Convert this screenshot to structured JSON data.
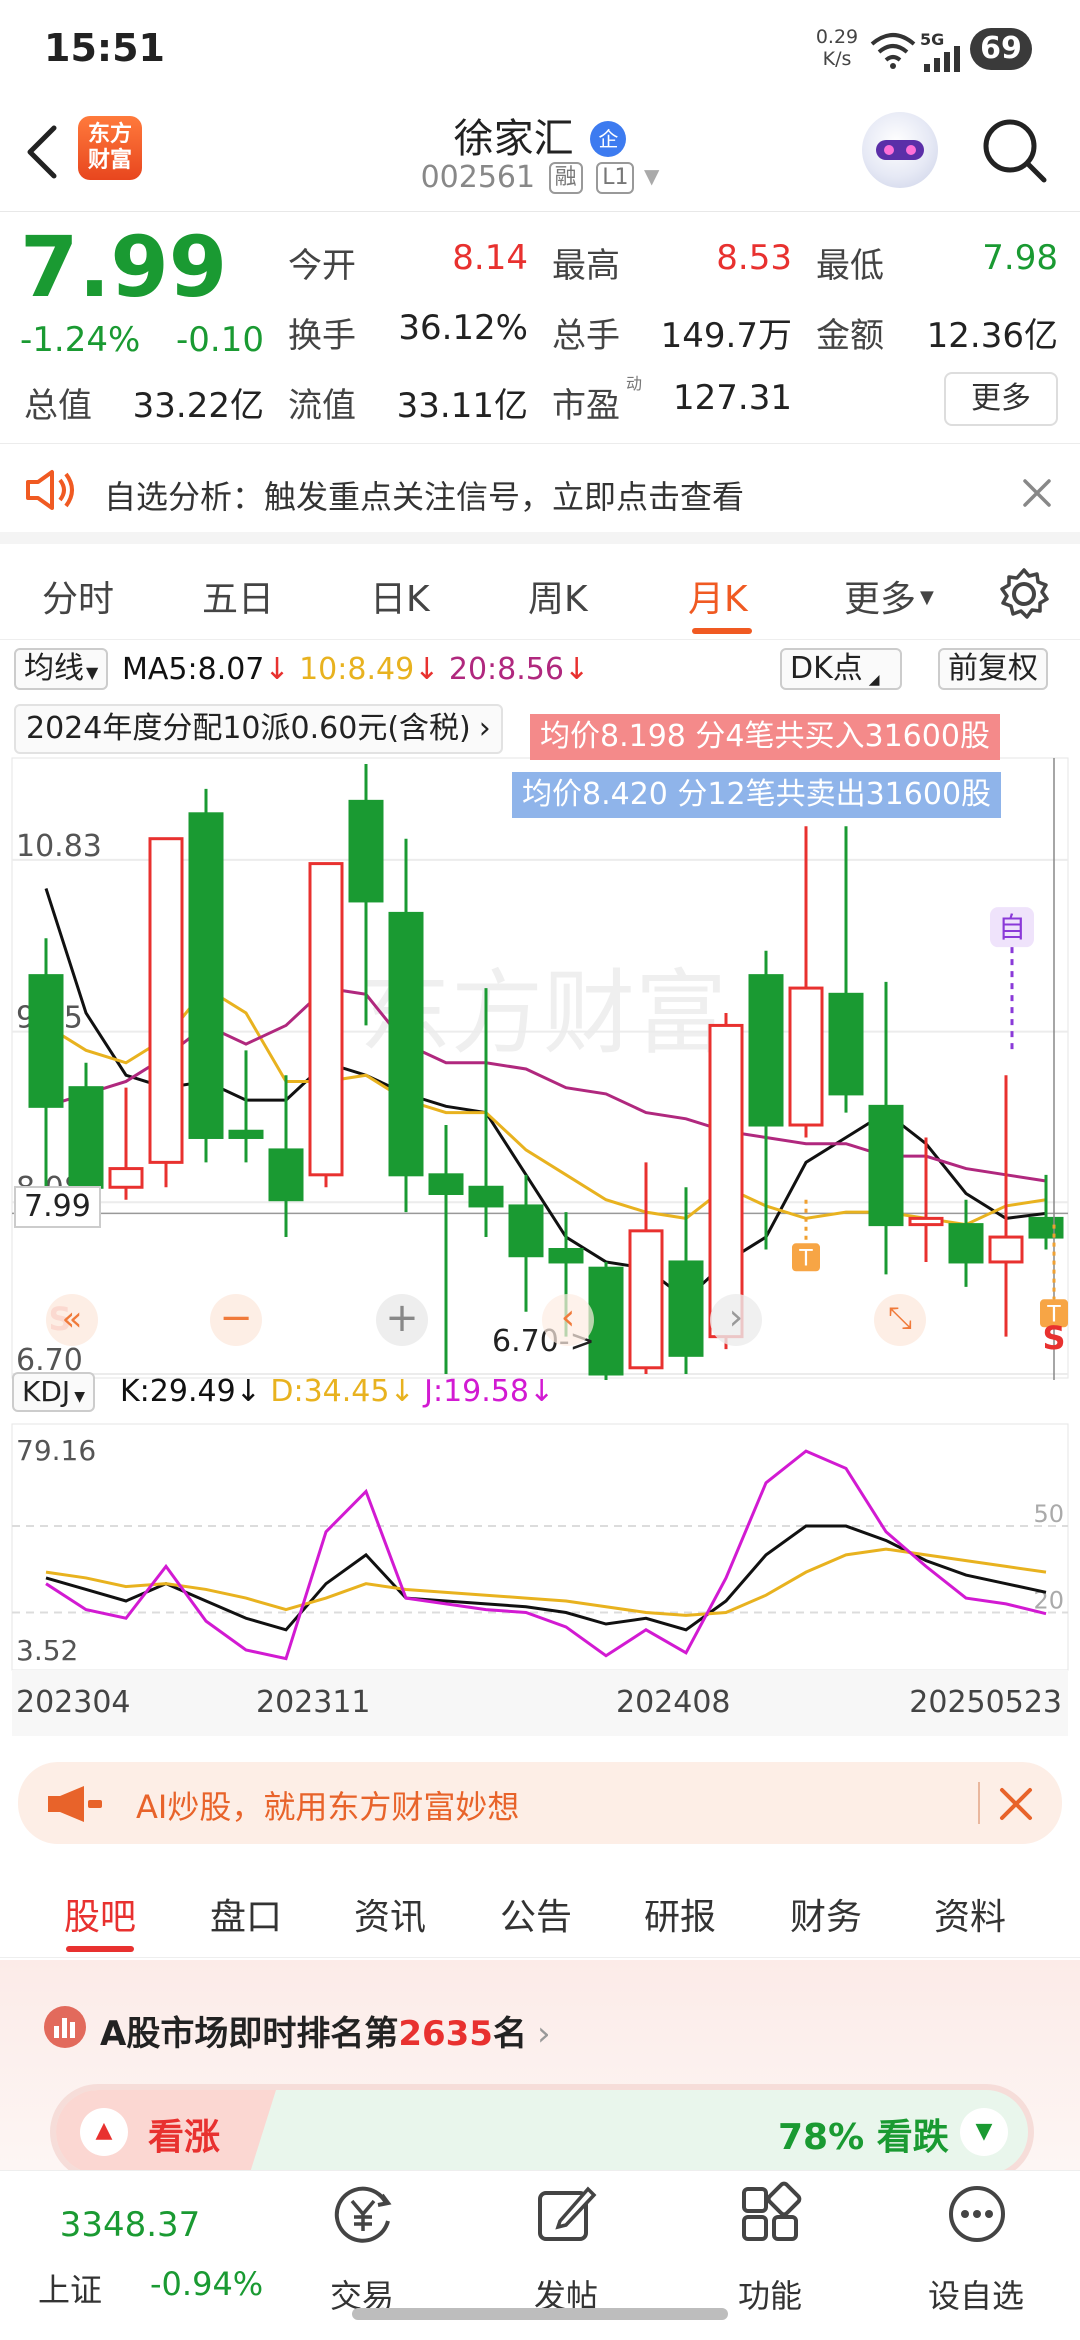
{
  "status_bar": {
    "time": "15:51",
    "net_speed_value": "0.29",
    "net_speed_unit": "K/s",
    "network": "5G",
    "battery": "69"
  },
  "header": {
    "logo_line1": "东方",
    "logo_line2": "财富",
    "stock_name": "徐家汇",
    "badge": "企",
    "stock_code": "002561",
    "tag_margin": "融",
    "tag_level": "L1"
  },
  "quote": {
    "price": "7.99",
    "change_pct": "-1.24%",
    "change": "-0.10",
    "open_label": "今开",
    "open": "8.14",
    "high_label": "最高",
    "high": "8.53",
    "low_label": "最低",
    "low": "7.98",
    "turnover_label": "换手",
    "turnover": "36.12%",
    "volume_label": "总手",
    "volume": "149.7万",
    "amount_label": "金额",
    "amount": "12.36亿",
    "mcap_label": "总值",
    "mcap": "33.22亿",
    "float_label": "流值",
    "float_mcap": "33.11亿",
    "pe_label": "市盈",
    "pe_sup": "动",
    "pe": "127.31",
    "more_label": "更多"
  },
  "alert": {
    "text": "自选分析：触发重点关注信号，立即点击查看"
  },
  "period_tabs": [
    {
      "label": "分时",
      "active": false
    },
    {
      "label": "五日",
      "active": false
    },
    {
      "label": "日K",
      "active": false
    },
    {
      "label": "周K",
      "active": false
    },
    {
      "label": "月K",
      "active": true
    },
    {
      "label": "更多",
      "active": false
    }
  ],
  "chart_header": {
    "indicator_select": "均线",
    "ma5": "MA5:8.07",
    "ma10": "10:8.49",
    "ma20": "20:8.56",
    "dk_label": "DK点",
    "adjust_label": "前复权",
    "dividend_note": "2024年度分配10派0.60元(含税)",
    "buy_note": "均价8.198  分4笔共买入31600股",
    "sell_note": "均价8.420  分12笔共卖出31600股"
  },
  "chart_data": [
    {
      "type": "candlestick",
      "title": "",
      "y_ticks": [
        "10.83",
        "9.45",
        "8.08",
        "6.70"
      ],
      "last_price_label": "7.99",
      "min_marker": "6.70->",
      "ylim": [
        6.7,
        11.6
      ],
      "candles": [
        {
          "o": 9.9,
          "c": 8.85,
          "h": 10.2,
          "l": 8.1
        },
        {
          "o": 9.0,
          "c": 8.2,
          "h": 9.2,
          "l": 7.9
        },
        {
          "o": 8.2,
          "c": 8.35,
          "h": 9.0,
          "l": 8.1
        },
        {
          "o": 8.4,
          "c": 11.0,
          "h": 11.0,
          "l": 8.2
        },
        {
          "o": 11.2,
          "c": 8.6,
          "h": 11.4,
          "l": 8.4
        },
        {
          "o": 8.65,
          "c": 8.6,
          "h": 9.3,
          "l": 8.4
        },
        {
          "o": 8.5,
          "c": 8.1,
          "h": 9.1,
          "l": 7.8
        },
        {
          "o": 8.3,
          "c": 10.8,
          "h": 10.8,
          "l": 8.2
        },
        {
          "o": 11.3,
          "c": 10.5,
          "h": 11.6,
          "l": 9.5
        },
        {
          "o": 10.4,
          "c": 8.3,
          "h": 11.0,
          "l": 8.0
        },
        {
          "o": 8.3,
          "c": 8.15,
          "h": 8.7,
          "l": 6.7
        },
        {
          "o": 8.2,
          "c": 8.05,
          "h": 9.8,
          "l": 7.8
        },
        {
          "o": 8.05,
          "c": 7.65,
          "h": 8.3,
          "l": 7.2
        },
        {
          "o": 7.7,
          "c": 7.6,
          "h": 8.0,
          "l": 7.0
        },
        {
          "o": 7.55,
          "c": 6.7,
          "h": 7.6,
          "l": 6.6
        },
        {
          "o": 6.75,
          "c": 7.85,
          "h": 8.4,
          "l": 6.7
        },
        {
          "o": 7.6,
          "c": 6.85,
          "h": 8.2,
          "l": 6.7
        },
        {
          "o": 7.0,
          "c": 9.5,
          "h": 9.6,
          "l": 6.9
        },
        {
          "o": 9.9,
          "c": 8.7,
          "h": 10.1,
          "l": 7.7
        },
        {
          "o": 8.7,
          "c": 9.8,
          "h": 11.1,
          "l": 8.6
        },
        {
          "o": 9.75,
          "c": 8.95,
          "h": 11.1,
          "l": 8.8
        },
        {
          "o": 8.85,
          "c": 7.9,
          "h": 9.85,
          "l": 7.5
        },
        {
          "o": 7.9,
          "c": 7.95,
          "h": 8.6,
          "l": 7.6
        },
        {
          "o": 7.9,
          "c": 7.6,
          "h": 8.1,
          "l": 7.4
        },
        {
          "o": 7.6,
          "c": 7.8,
          "h": 9.1,
          "l": 7.0
        },
        {
          "o": 7.95,
          "c": 7.8,
          "h": 8.3,
          "l": 7.7
        }
      ],
      "series": [
        {
          "name": "MA5",
          "color": "#111111",
          "values": [
            10.6,
            9.6,
            9.1,
            9.0,
            9.05,
            8.9,
            8.9,
            9.2,
            9.1,
            8.95,
            8.85,
            8.8,
            8.3,
            7.8,
            7.6,
            7.55,
            7.3,
            7.6,
            7.8,
            8.4,
            8.6,
            8.8,
            8.55,
            8.15,
            7.95,
            7.99
          ]
        },
        {
          "name": "MA10",
          "color": "#e8b21f",
          "values": [
            9.5,
            9.3,
            9.2,
            9.4,
            9.8,
            9.6,
            9.05,
            9.05,
            9.1,
            8.9,
            8.8,
            8.8,
            8.5,
            8.3,
            8.1,
            8.0,
            7.95,
            8.2,
            8.05,
            7.95,
            8.0,
            8.0,
            7.95,
            7.9,
            8.05,
            8.1
          ]
        },
        {
          "name": "MA20",
          "color": "#b0287e",
          "values": [
            8.85,
            8.95,
            9.05,
            9.25,
            9.5,
            9.35,
            9.5,
            9.8,
            9.75,
            9.35,
            9.2,
            9.2,
            9.15,
            9.0,
            8.95,
            8.8,
            8.75,
            8.65,
            8.6,
            8.55,
            8.55,
            8.45,
            8.45,
            8.35,
            8.3,
            8.25
          ]
        }
      ],
      "markers": [
        {
          "label": "自",
          "index": 25
        },
        {
          "label": "S",
          "index": 25
        }
      ]
    },
    {
      "type": "line",
      "title": "",
      "indicator_select": "KDJ",
      "k_label": "K:29.49",
      "d_label": "D:34.45",
      "j_label": "J:19.58",
      "y_ticks_left": [
        "79.16",
        "3.52"
      ],
      "y_ticks_right": [
        "50",
        "20"
      ],
      "ylim": [
        3.52,
        79.16
      ],
      "x_ticks": [
        "202304",
        "202311",
        "202408",
        "20250523"
      ],
      "series": [
        {
          "name": "K",
          "color": "#111111",
          "values": [
            32,
            28,
            24,
            30,
            24,
            18,
            14,
            30,
            40,
            25,
            24,
            23,
            22,
            20,
            16,
            18,
            14,
            24,
            40,
            50,
            50,
            45,
            38,
            33,
            30,
            27
          ]
        },
        {
          "name": "D",
          "color": "#e8b21f",
          "values": [
            34,
            32,
            29,
            30,
            28,
            25,
            21,
            25,
            30,
            28,
            27,
            26,
            25,
            24,
            22,
            20,
            19,
            20,
            26,
            34,
            40,
            42,
            40,
            38,
            36,
            34
          ]
        },
        {
          "name": "J",
          "color": "#d21ad2",
          "values": [
            30,
            21,
            18,
            36,
            17,
            7,
            4,
            48,
            62,
            25,
            23,
            21,
            20,
            15,
            5,
            14,
            6,
            32,
            65,
            76,
            70,
            48,
            36,
            25,
            23,
            19.58
          ]
        }
      ]
    }
  ],
  "ai_banner": {
    "text": "AI炒股，就用东方财富妙想"
  },
  "section_tabs": [
    {
      "label": "股吧",
      "active": true
    },
    {
      "label": "盘口",
      "active": false
    },
    {
      "label": "资讯",
      "active": false
    },
    {
      "label": "公告",
      "active": false
    },
    {
      "label": "研报",
      "active": false
    },
    {
      "label": "财务",
      "active": false
    },
    {
      "label": "资料",
      "active": false
    }
  ],
  "rank": {
    "prefix": "A股市场即时排名第",
    "number": "2635",
    "suffix": "名"
  },
  "vote": {
    "up_label": "看涨",
    "down_label": "78% 看跌",
    "down_pct": 78
  },
  "bottom_nav": {
    "index_value": "3348.37",
    "index_name": "上证",
    "index_change": "-0.94%",
    "items": [
      "交易",
      "发帖",
      "功能",
      "设自选"
    ]
  },
  "colors": {
    "up": "#e8312f",
    "down": "#1a9a32",
    "accent": "#f05a22"
  }
}
